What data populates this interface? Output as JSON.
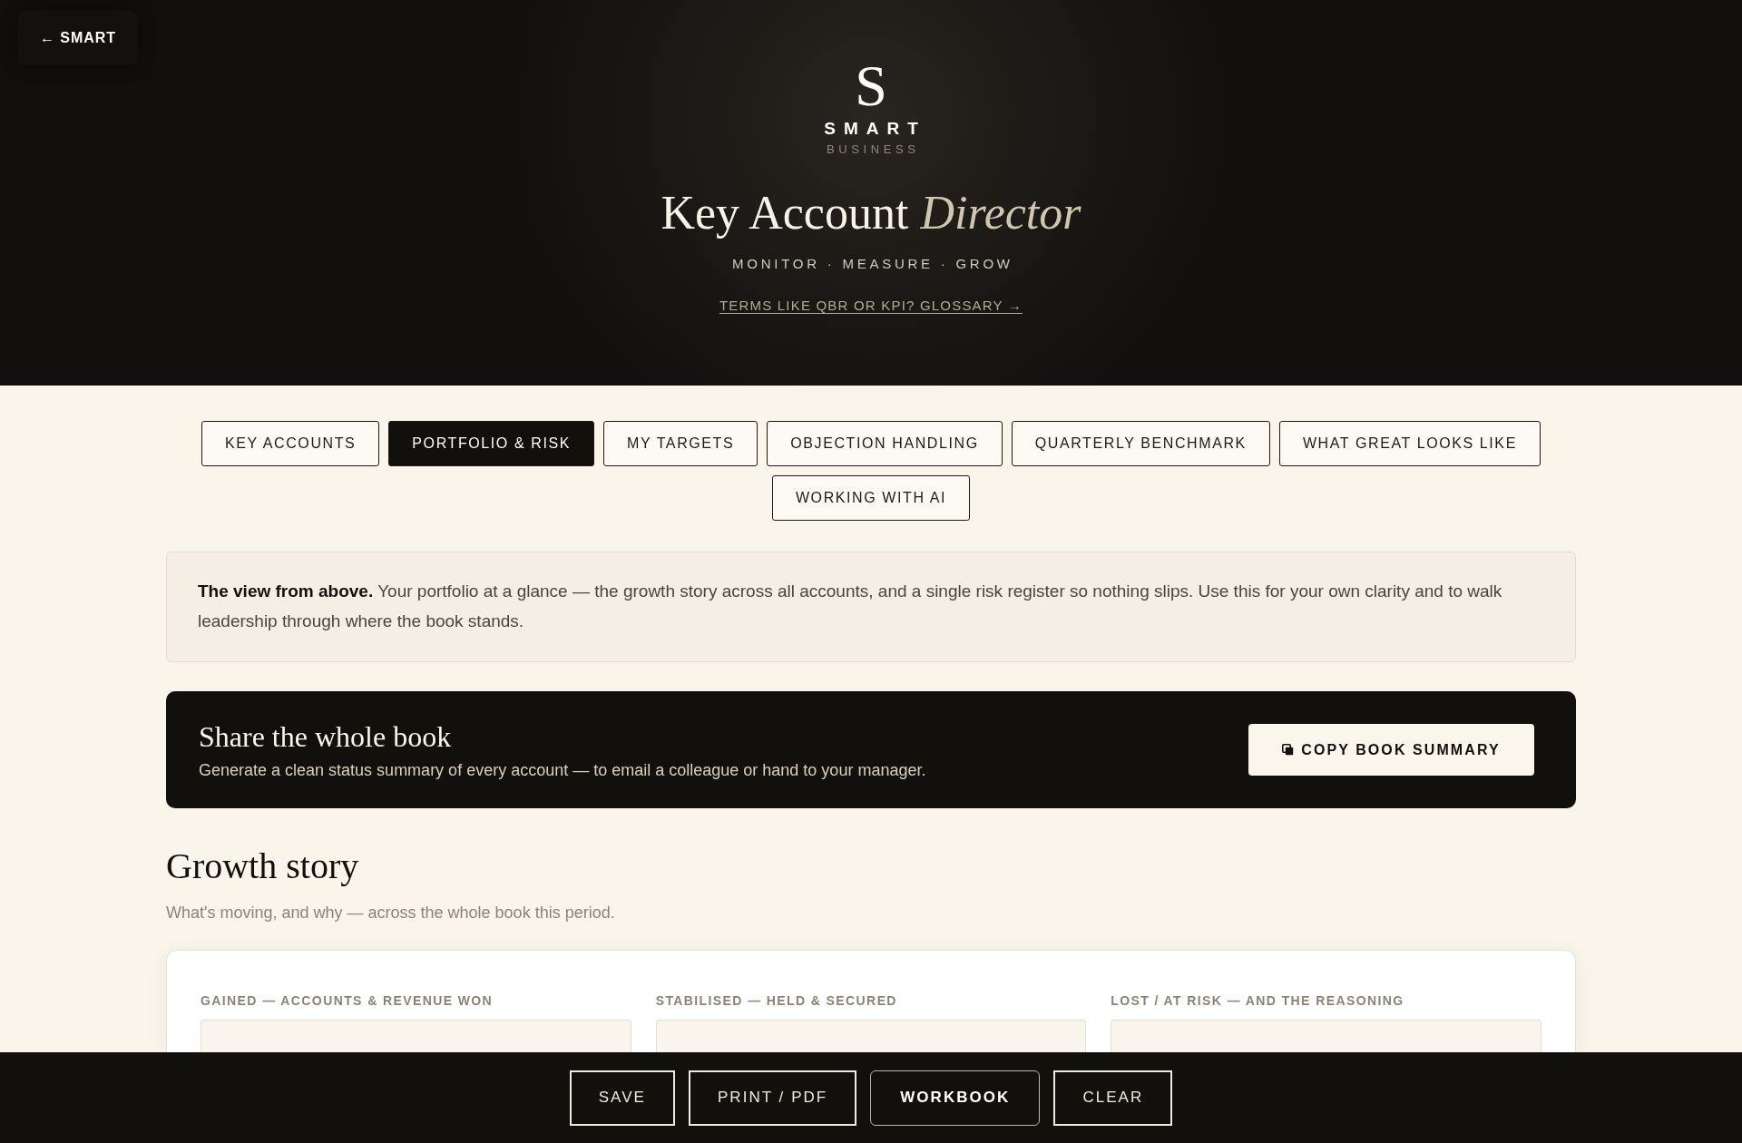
{
  "back_link": "← SMART",
  "brand": {
    "monogram": "S",
    "name": "SMART",
    "tagline": "BUSINESS"
  },
  "hero": {
    "title": "Key Account *Director*",
    "motto": "MONITOR · MEASURE · GROW",
    "glossary_link": "TERMS LIKE QBR OR KPI? GLOSSARY →"
  },
  "tabs": [
    {
      "label": "KEY ACCOUNTS",
      "selected": false
    },
    {
      "label": "PORTFOLIO & RISK",
      "selected": true
    },
    {
      "label": "MY TARGETS",
      "selected": false
    },
    {
      "label": "OBJECTION HANDLING",
      "selected": false
    },
    {
      "label": "QUARTERLY BENCHMARK",
      "selected": false
    },
    {
      "label": "WHAT GREAT LOOKS LIKE",
      "selected": false
    },
    {
      "label": "WORKING WITH AI",
      "selected": false
    }
  ],
  "intro": {
    "text": "**The view from above.** Your portfolio at a glance — the growth story across all accounts, and a single risk register so nothing slips. Use this for your own clarity and to walk leadership through where the book stands."
  },
  "share_panel": {
    "title": "Share the whole book",
    "description": "Generate a clean status summary of every account — to email a colleague or hand to your manager.",
    "button": "COPY BOOK SUMMARY"
  },
  "growth_story": {
    "title": "Growth story",
    "subtitle": "What's moving, and why — across the whole book this period.",
    "fields": [
      {
        "label": "GAINED — ACCOUNTS & REVENUE WON"
      },
      {
        "label": "STABILISED — HELD & SECURED"
      },
      {
        "label": "LOST / AT RISK — AND THE REASONING"
      }
    ]
  },
  "actions": [
    {
      "label": "SAVE",
      "kind": "outline"
    },
    {
      "label": "PRINT / PDF",
      "kind": "outline"
    },
    {
      "label": "WORKBOOK",
      "kind": "primary"
    },
    {
      "label": "CLEAR",
      "kind": "outline"
    }
  ]
}
